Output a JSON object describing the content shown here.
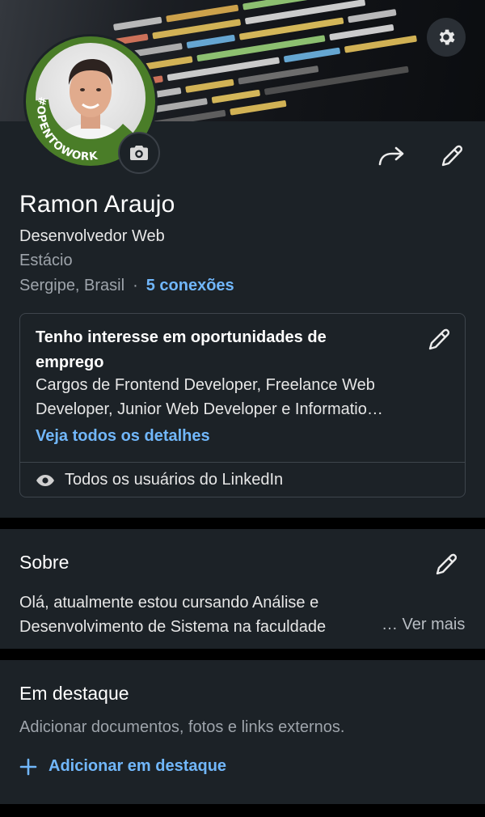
{
  "icons": {
    "settings": "gear-icon",
    "camera": "camera-icon",
    "share": "share-arrow-icon",
    "edit": "pencil-icon",
    "visibility": "eye-icon",
    "add": "plus-icon"
  },
  "colors": {
    "background": "#000000",
    "card": "#1c2227",
    "accent_link": "#71b7fb",
    "open_to_work_green": "#4a7d28"
  },
  "profile": {
    "badge_text": "#OPENTOWORK",
    "name": "Ramon Araujo",
    "headline": "Desenvolvedor Web",
    "school": "Estácio",
    "location": "Sergipe, Brasil",
    "separator": "·",
    "connections": "5 conexões"
  },
  "open_to_work": {
    "title": "Tenho interesse em oportunidades de emprego",
    "description": "Cargos de Frontend Developer, Freelance Web Developer, Junior Web Developer e Informatio…",
    "details_link": "Veja todos os detalhes",
    "visibility": "Todos os usuários do LinkedIn"
  },
  "about": {
    "title": "Sobre",
    "text": "Olá, atualmente estou cursando Análise e Desenvolvimento de Sistema na faculdade Estácio",
    "see_more": "… Ver mais"
  },
  "featured": {
    "title": "Em destaque",
    "description": "Adicionar documentos, fotos e links externos.",
    "add_label": "Adicionar em destaque"
  }
}
